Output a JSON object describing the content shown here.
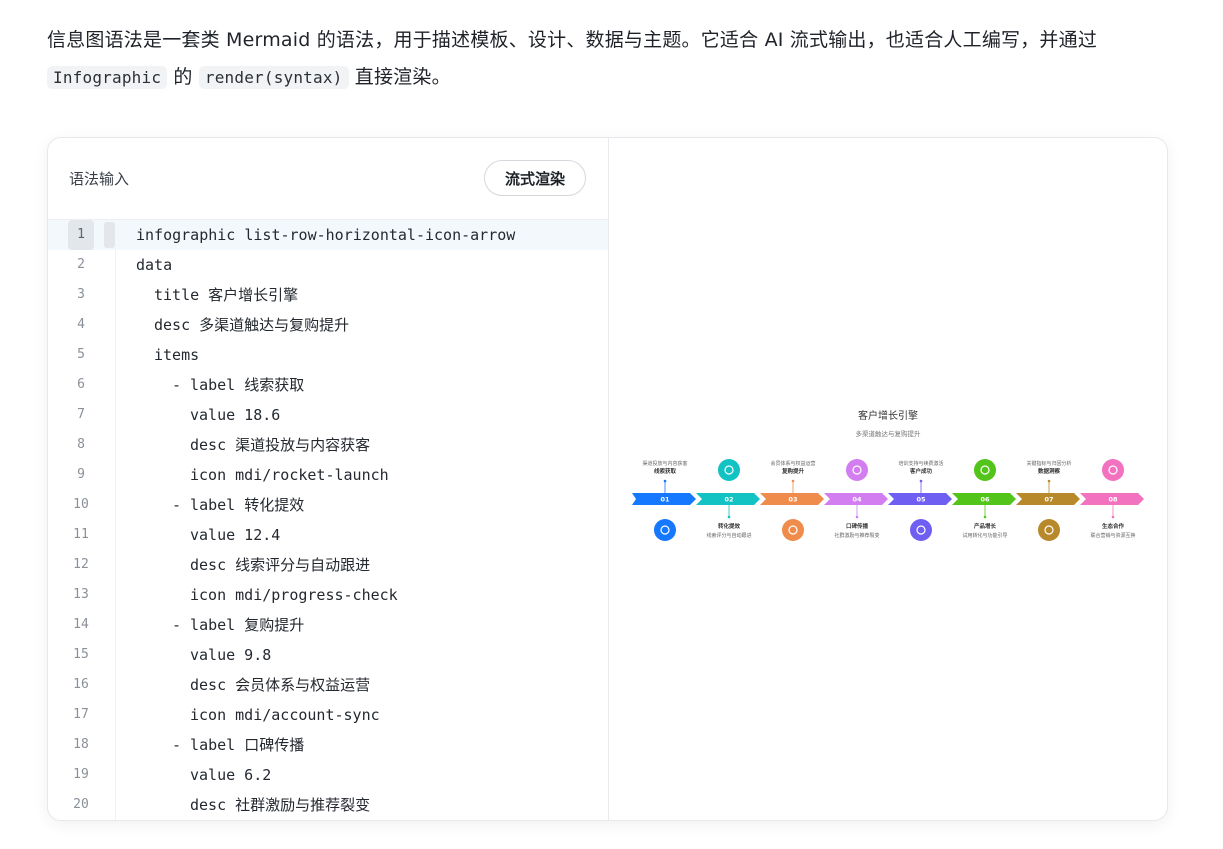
{
  "intro": {
    "text1": "信息图语法是一套类 Mermaid 的语法，用于描述模板、设计、数据与主题。它适合 AI 流式输出，也适合人工编写，并通过 ",
    "code1": "Infographic",
    "text2": " 的 ",
    "code2": "render(syntax)",
    "text3": " 直接渲染。"
  },
  "editor": {
    "title": "语法输入",
    "render_button": "流式渲染",
    "lines": [
      {
        "n": "1",
        "indent": 0,
        "text": "infographic list-row-horizontal-icon-arrow"
      },
      {
        "n": "2",
        "indent": 0,
        "text": "data"
      },
      {
        "n": "3",
        "indent": 1,
        "text": "title 客户增长引擎"
      },
      {
        "n": "4",
        "indent": 1,
        "text": "desc 多渠道触达与复购提升"
      },
      {
        "n": "5",
        "indent": 1,
        "text": "items"
      },
      {
        "n": "6",
        "indent": 2,
        "text": "- label 线索获取"
      },
      {
        "n": "7",
        "indent": 3,
        "text": "value 18.6"
      },
      {
        "n": "8",
        "indent": 3,
        "text": "desc 渠道投放与内容获客"
      },
      {
        "n": "9",
        "indent": 3,
        "text": "icon mdi/rocket-launch"
      },
      {
        "n": "10",
        "indent": 2,
        "text": "- label 转化提效"
      },
      {
        "n": "11",
        "indent": 3,
        "text": "value 12.4"
      },
      {
        "n": "12",
        "indent": 3,
        "text": "desc 线索评分与自动跟进"
      },
      {
        "n": "13",
        "indent": 3,
        "text": "icon mdi/progress-check"
      },
      {
        "n": "14",
        "indent": 2,
        "text": "- label 复购提升"
      },
      {
        "n": "15",
        "indent": 3,
        "text": "value 9.8"
      },
      {
        "n": "16",
        "indent": 3,
        "text": "desc 会员体系与权益运营"
      },
      {
        "n": "17",
        "indent": 3,
        "text": "icon mdi/account-sync"
      },
      {
        "n": "18",
        "indent": 2,
        "text": "- label 口碑传播"
      },
      {
        "n": "19",
        "indent": 3,
        "text": "value 6.2"
      },
      {
        "n": "20",
        "indent": 3,
        "text": "desc 社群激励与推荐裂变"
      }
    ]
  },
  "infographic": {
    "title": "客户增长引擎",
    "subtitle": "多渠道触达与复购提升",
    "items": [
      {
        "num": "01",
        "label": "线索获取",
        "desc": "渠道投放与内容获客",
        "color": "#1677ff",
        "icon": "rocket-icon"
      },
      {
        "num": "02",
        "label": "转化提效",
        "desc": "线索评分与自动跟进",
        "color": "#13c2c2",
        "icon": "progress-check-icon"
      },
      {
        "num": "03",
        "label": "复购提升",
        "desc": "会员体系与权益运营",
        "color": "#f08c4b",
        "icon": "account-sync-icon"
      },
      {
        "num": "04",
        "label": "口碑传播",
        "desc": "社群激励与推荐裂变",
        "color": "#d27ef0",
        "icon": "account-group-icon"
      },
      {
        "num": "05",
        "label": "客户成功",
        "desc": "培训支持与续费激活",
        "color": "#6f5ef2",
        "icon": "book-icon"
      },
      {
        "num": "06",
        "label": "产品增长",
        "desc": "试用转化与功能引导",
        "color": "#52c41a",
        "icon": "chart-line-icon"
      },
      {
        "num": "07",
        "label": "数据洞察",
        "desc": "关键指标与归因分析",
        "color": "#b8892a",
        "icon": "chart-area-icon"
      },
      {
        "num": "08",
        "label": "生态合作",
        "desc": "联合营销与资源互换",
        "color": "#f272c0",
        "icon": "handshake-icon"
      }
    ]
  }
}
